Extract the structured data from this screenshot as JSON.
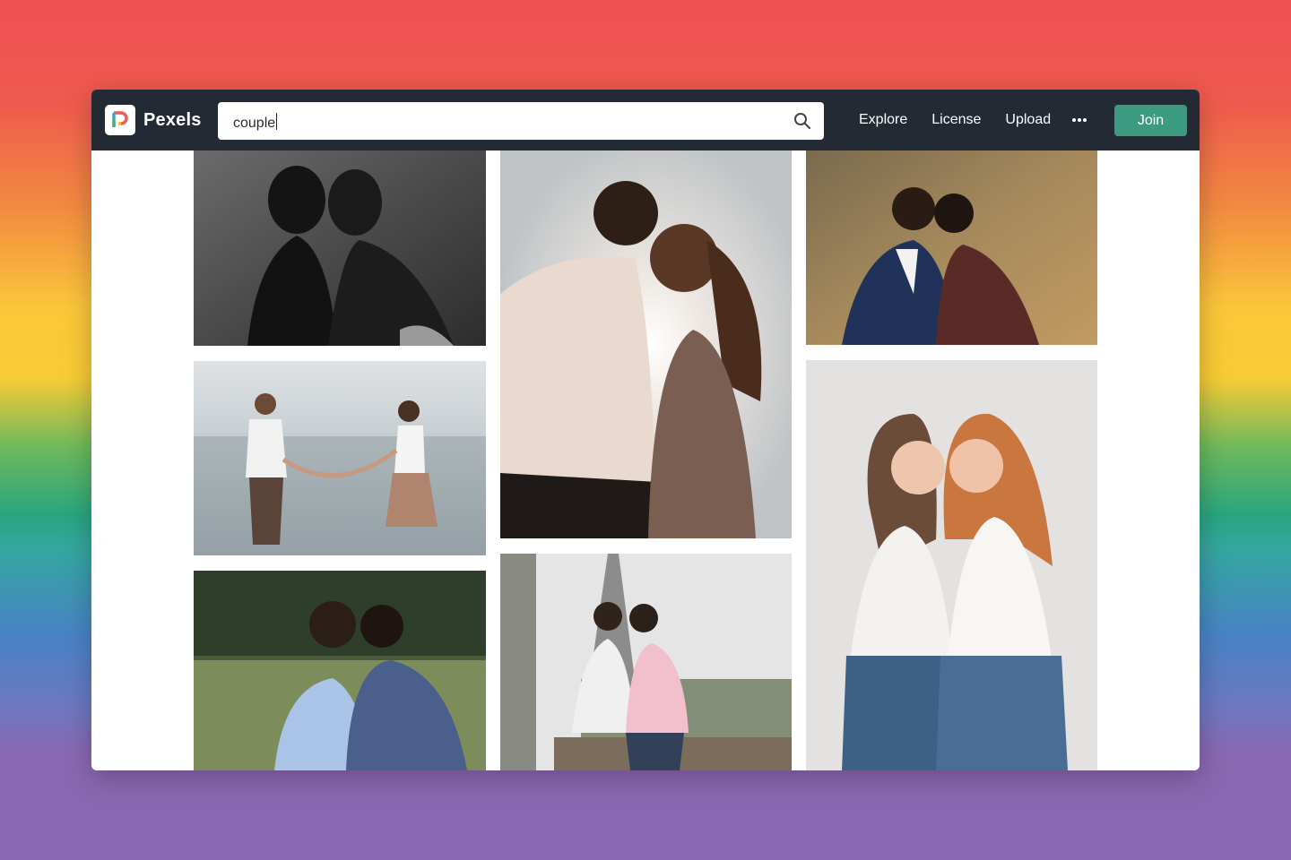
{
  "brand": {
    "name": "Pexels"
  },
  "search": {
    "value": "couple",
    "placeholder": ""
  },
  "nav": {
    "links": [
      "Explore",
      "License",
      "Upload"
    ],
    "join_label": "Join"
  },
  "colors": {
    "navbar": "#232a34",
    "join_button": "#3b9a7f",
    "page_background": "#ffffff"
  },
  "photos": [
    {
      "id": "photo-1",
      "subject": "black-and-white couple foreheads touching",
      "column": 1
    },
    {
      "id": "photo-2",
      "subject": "couple kissing at sunset by the water",
      "column": 2
    },
    {
      "id": "photo-3",
      "subject": "couple sitting in formal wear outdoors",
      "column": 3
    },
    {
      "id": "photo-4",
      "subject": "couple holding hands at the beach",
      "column": 1
    },
    {
      "id": "photo-5",
      "subject": "two women embracing in white tees and jeans",
      "column": 3
    },
    {
      "id": "photo-6",
      "subject": "couple smiling cheek to cheek in a park",
      "column": 1
    },
    {
      "id": "photo-7",
      "subject": "two men kissing near the Eiffel Tower",
      "column": 2
    }
  ]
}
